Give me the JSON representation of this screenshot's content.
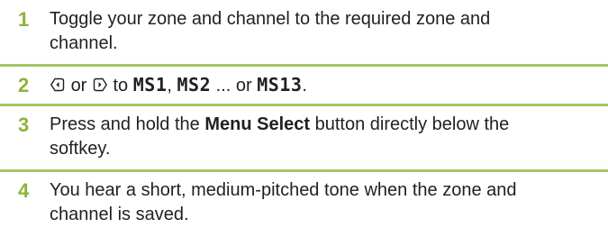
{
  "steps": [
    {
      "number": "1",
      "text": "Toggle your zone and channel to the required zone and channel."
    },
    {
      "number": "2",
      "or_word": "or",
      "to_word": "to",
      "lcd_1": "MS1",
      "sep_1": ",",
      "lcd_2": "MS2",
      "ellipsis_or": "... or",
      "lcd_3": "MS13",
      "end": ".",
      "icons": [
        "left-navigation-key-icon",
        "right-navigation-key-icon"
      ]
    },
    {
      "number": "3",
      "text_before": "Press and hold the",
      "bold_text": "Menu Select",
      "text_after": "button directly below the softkey."
    },
    {
      "number": "4",
      "text": "You hear a short, medium-pitched tone when the zone and channel is saved."
    }
  ],
  "colors": {
    "step_number": "#8db33b",
    "divider": "#a6c468",
    "text": "#231f20"
  }
}
